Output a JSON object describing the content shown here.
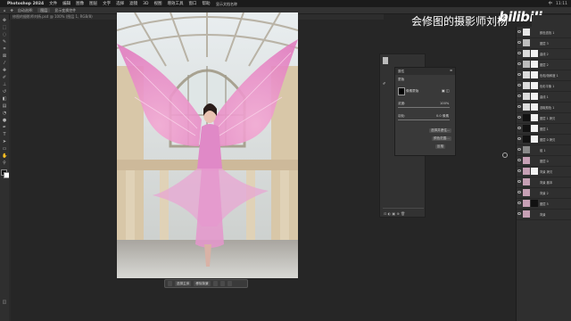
{
  "menubar": {
    "app_name": "Photoshop 2024",
    "items": [
      "文件",
      "编辑",
      "图像",
      "图层",
      "文字",
      "选择",
      "滤镜",
      "3D",
      "视图",
      "增效工具",
      "窗口",
      "帮助"
    ],
    "right_status": [
      "中",
      "11:11"
    ]
  },
  "window": {
    "file_title": "显示文档名称"
  },
  "optbar": {
    "items": [
      "自动选择:",
      "图层",
      "显示变换控件"
    ]
  },
  "tabbar": {
    "label": "修图的摄影师刘杨.psd @ 100% (图层 1, RGB/8)"
  },
  "context_bar": {
    "btn1": "选择主体",
    "btn2": "移除背景"
  },
  "watermark": {
    "text": "会修图的摄影师刘杨",
    "logo": "bilibili"
  },
  "props": {
    "title": "属性",
    "header": "蒙版",
    "row1": "像素蒙版",
    "density_label": "浓度:",
    "density_value": "100%",
    "feather_label": "羽化:",
    "feather_value": "0.0 像素",
    "refine_btn": "选择并遮住...",
    "color_range_btn": "颜色范围...",
    "invert_btn": "反相"
  },
  "layers": {
    "names": [
      "颜色查找 1",
      "图层 3",
      "曲线 2",
      "图层 2",
      "色相/饱和度 1",
      "色彩平衡 1",
      "曲线 1",
      "选取颜色 1",
      "图层 1 拷贝",
      "图层 1",
      "图层 0 拷贝",
      "组 1",
      "图层 0",
      "背景 拷贝",
      "背景 副本",
      "背景 2",
      "图层 5",
      "背景"
    ],
    "colors": {
      "thumb_light": "#bdbdbd",
      "thumb_dark": "#111111",
      "mask_white": "#f2f2f2"
    }
  }
}
